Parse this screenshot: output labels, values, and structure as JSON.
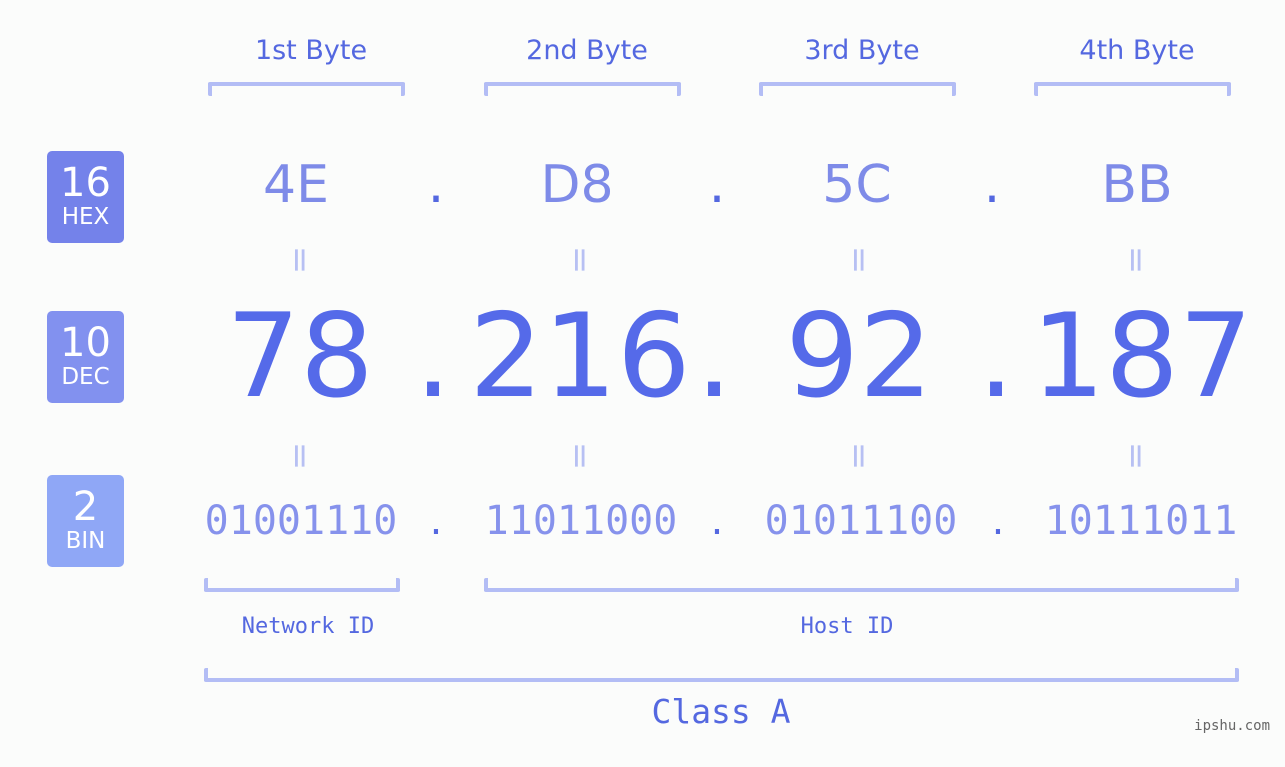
{
  "badges": [
    {
      "number": "16",
      "label": "HEX",
      "color": "#7482ea"
    },
    {
      "number": "10",
      "label": "DEC",
      "color": "#8291ef"
    },
    {
      "number": "2",
      "label": "BIN",
      "color": "#8fa7f6"
    }
  ],
  "bytes": [
    {
      "label": "1st Byte",
      "hex": "4E",
      "dec": "78",
      "bin": "01001110"
    },
    {
      "label": "2nd Byte",
      "hex": "D8",
      "dec": "216",
      "bin": "11011000"
    },
    {
      "label": "3rd Byte",
      "hex": "5C",
      "dec": "92",
      "bin": "01011100"
    },
    {
      "label": "4th Byte",
      "hex": "BB",
      "dec": "187",
      "bin": "10111011"
    }
  ],
  "separator": ".",
  "equals_symbol": "=",
  "network_id_label": "Network ID",
  "host_id_label": "Host ID",
  "class_label": "Class A",
  "watermark": "ipshu.com",
  "colors": {
    "accent": "#556ae9",
    "bracket": "#b3bdf5",
    "hex_text": "#7e8be8",
    "bin_text": "#8692ec"
  }
}
